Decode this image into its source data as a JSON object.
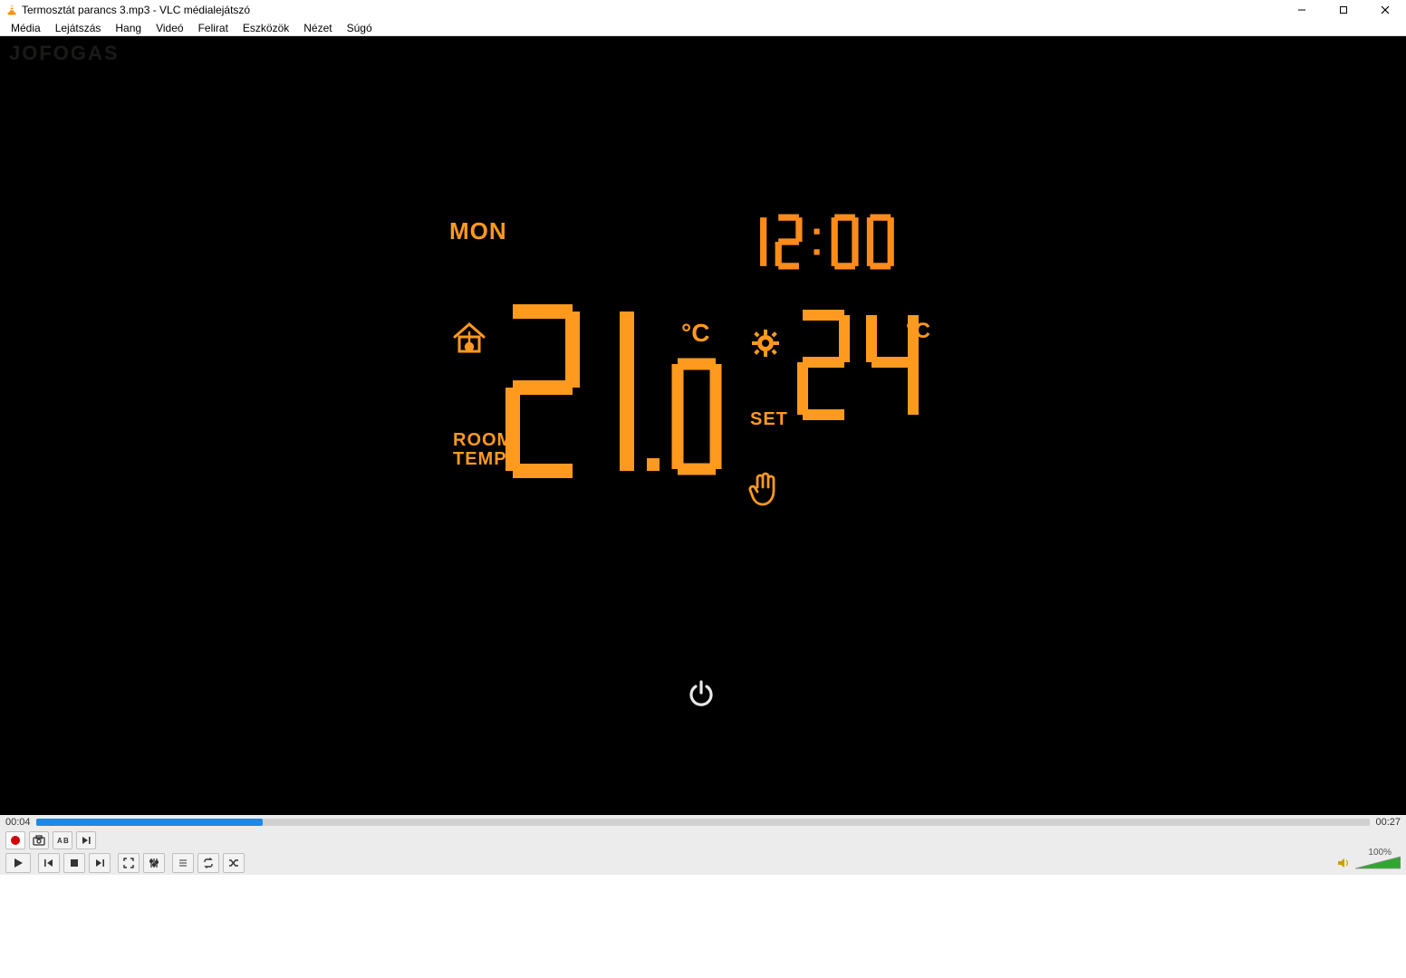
{
  "window": {
    "title": "Termosztát parancs 3.mp3 - VLC médialejátszó"
  },
  "menu": {
    "items": [
      "Média",
      "Lejátszás",
      "Hang",
      "Videó",
      "Felirat",
      "Eszközök",
      "Nézet",
      "Súgó"
    ]
  },
  "watermark": "JOFOGAS",
  "thermostat": {
    "day": "MON",
    "clock": "12:00",
    "room_label_line1": "ROOM",
    "room_label_line2": "TEMP",
    "room_temp": "21.0",
    "room_unit": "°C",
    "set_label": "SET",
    "set_temp": "24",
    "set_unit": "°C"
  },
  "playback": {
    "elapsed": "00:04",
    "total": "00:27",
    "progress_pct": 17
  },
  "volume": {
    "label": "100%",
    "level_pct": 100
  }
}
